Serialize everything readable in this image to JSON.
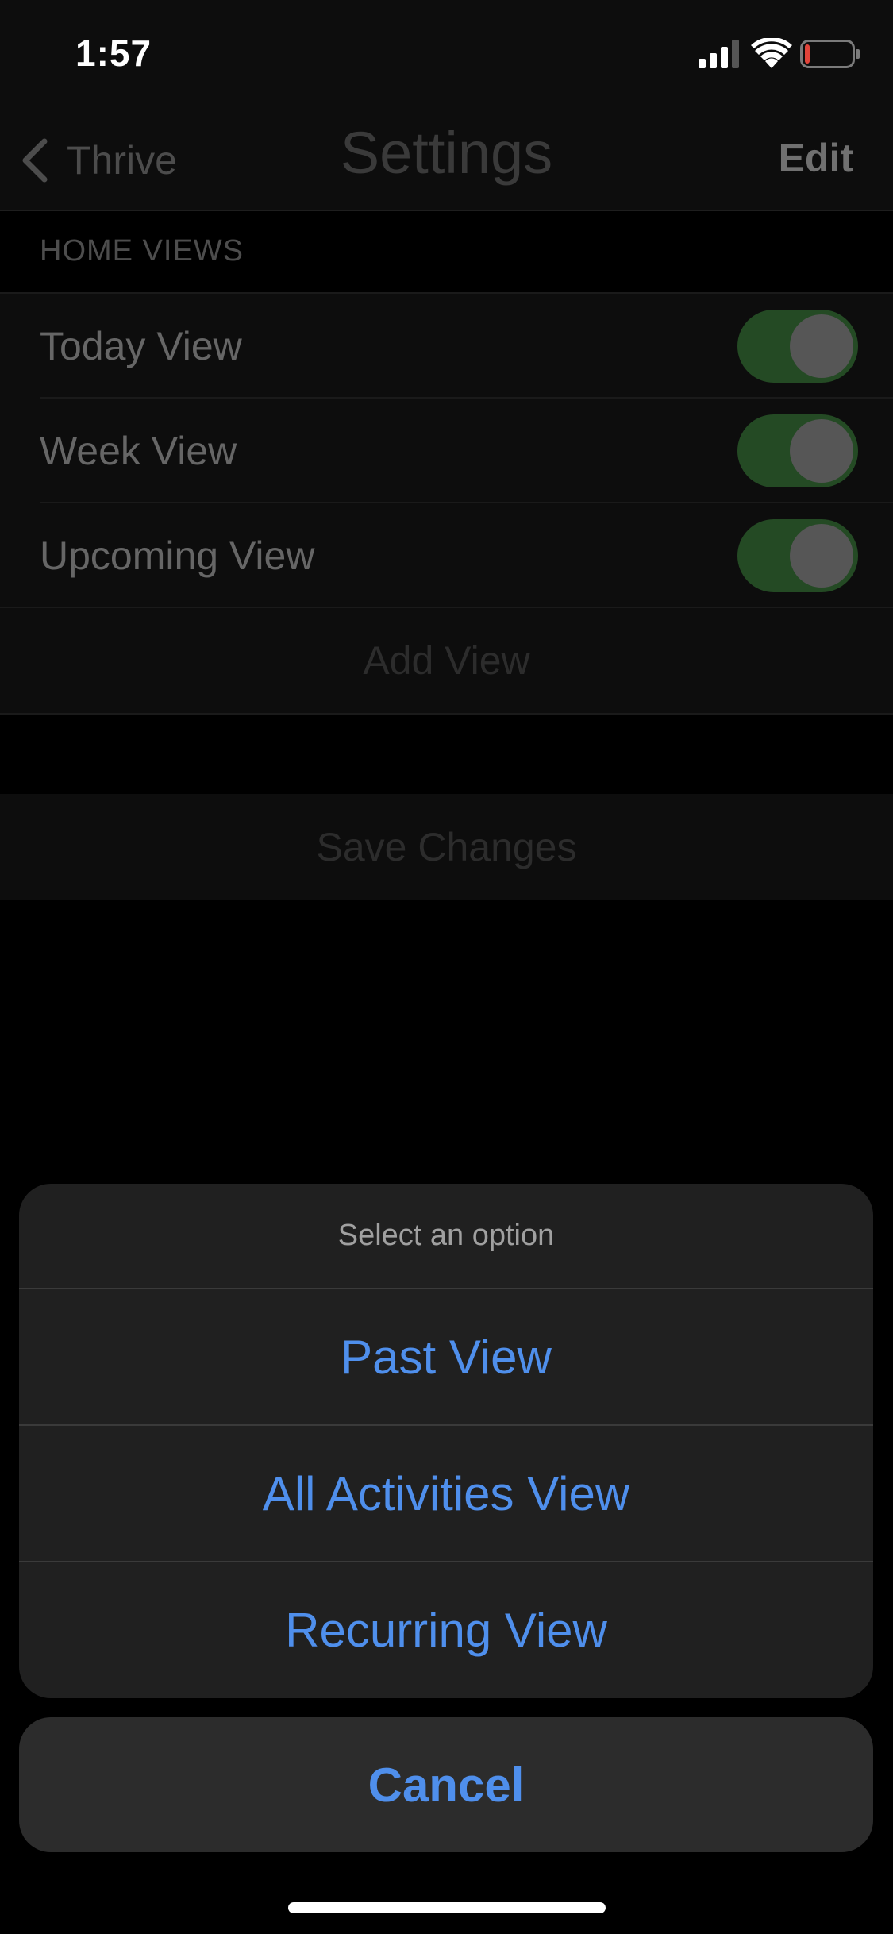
{
  "status_bar": {
    "time": "1:57",
    "signal_icon": "cellular-signal-icon",
    "wifi_icon": "wifi-icon",
    "battery_icon": "battery-low-icon",
    "battery_color": "#e0443a"
  },
  "nav": {
    "back_label": "Thrive",
    "back_icon": "chevron-left-icon",
    "title": "Settings",
    "edit_label": "Edit"
  },
  "section": {
    "header": "HOME VIEWS",
    "rows": [
      {
        "label": "Today View",
        "enabled": true
      },
      {
        "label": "Week View",
        "enabled": true
      },
      {
        "label": "Upcoming View",
        "enabled": true
      }
    ],
    "add_label": "Add View"
  },
  "save_label": "Save Changes",
  "action_sheet": {
    "title": "Select an option",
    "options": [
      {
        "label": "Past View"
      },
      {
        "label": "All Activities View"
      },
      {
        "label": "Recurring View"
      }
    ],
    "cancel_label": "Cancel",
    "accent_color": "#4f8fec"
  },
  "colors": {
    "toggle_on": "#244a24",
    "background": "#000000"
  }
}
